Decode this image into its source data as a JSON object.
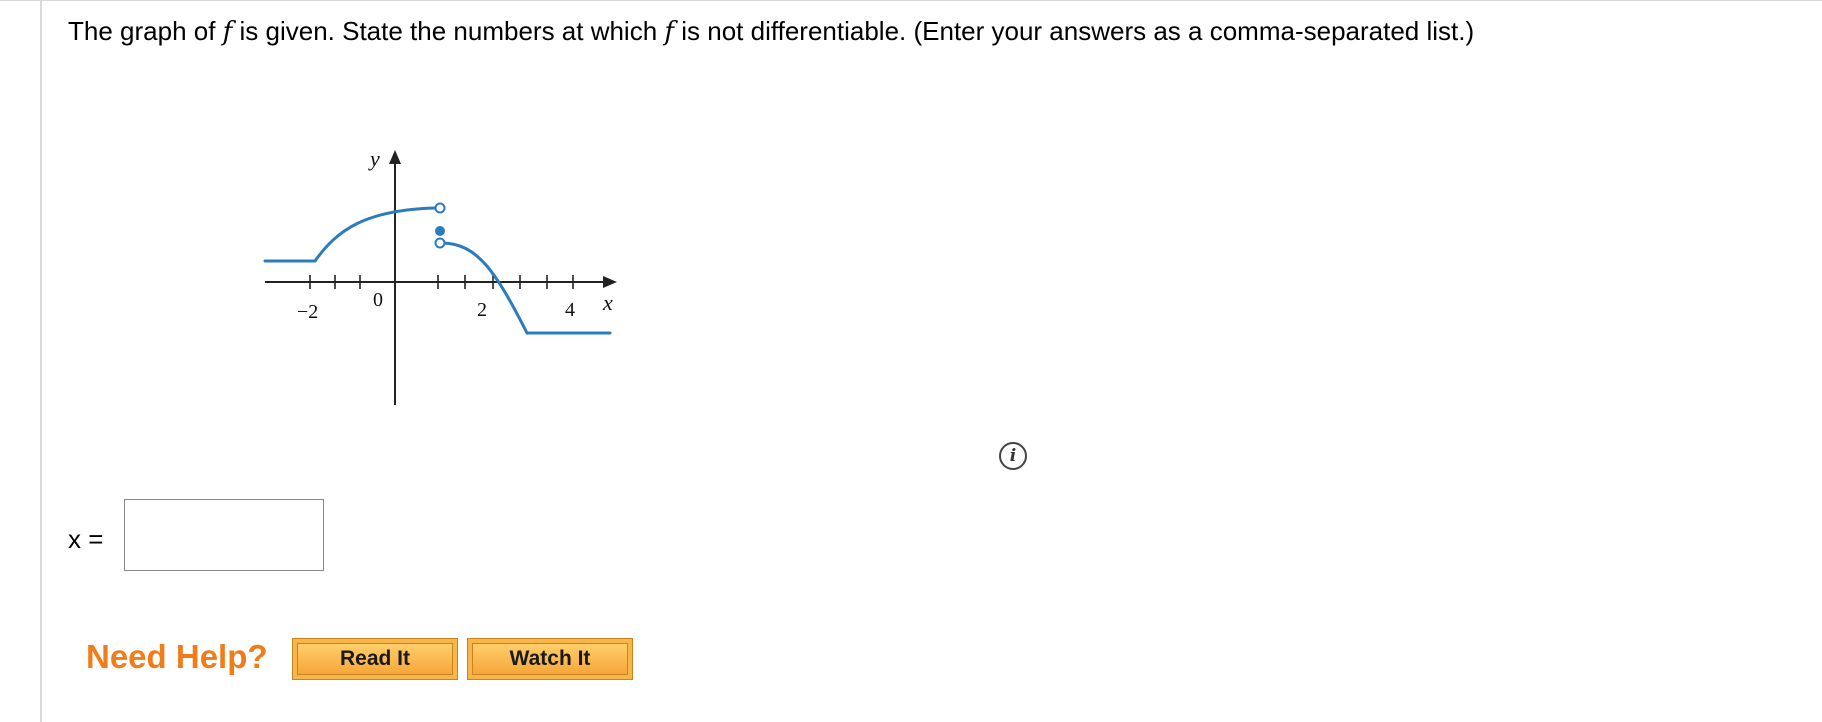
{
  "question": {
    "part1": "The graph of ",
    "f1": "f",
    "part2": " is given. State the numbers at which ",
    "f2": "f",
    "part3": " is not differentiable. (Enter your answers as a comma-separated list.)"
  },
  "graph": {
    "y_label": "y",
    "x_label": "x",
    "tick_labels": [
      "−2",
      "0",
      "2",
      "4"
    ],
    "curve_color": "#2b7bbf"
  },
  "info_icon": {
    "glyph": "i"
  },
  "answer": {
    "label": "x =",
    "value": "",
    "placeholder": ""
  },
  "help": {
    "title": "Need Help?",
    "read_label": "Read It",
    "watch_label": "Watch It",
    "accent": "#f07c1a"
  }
}
